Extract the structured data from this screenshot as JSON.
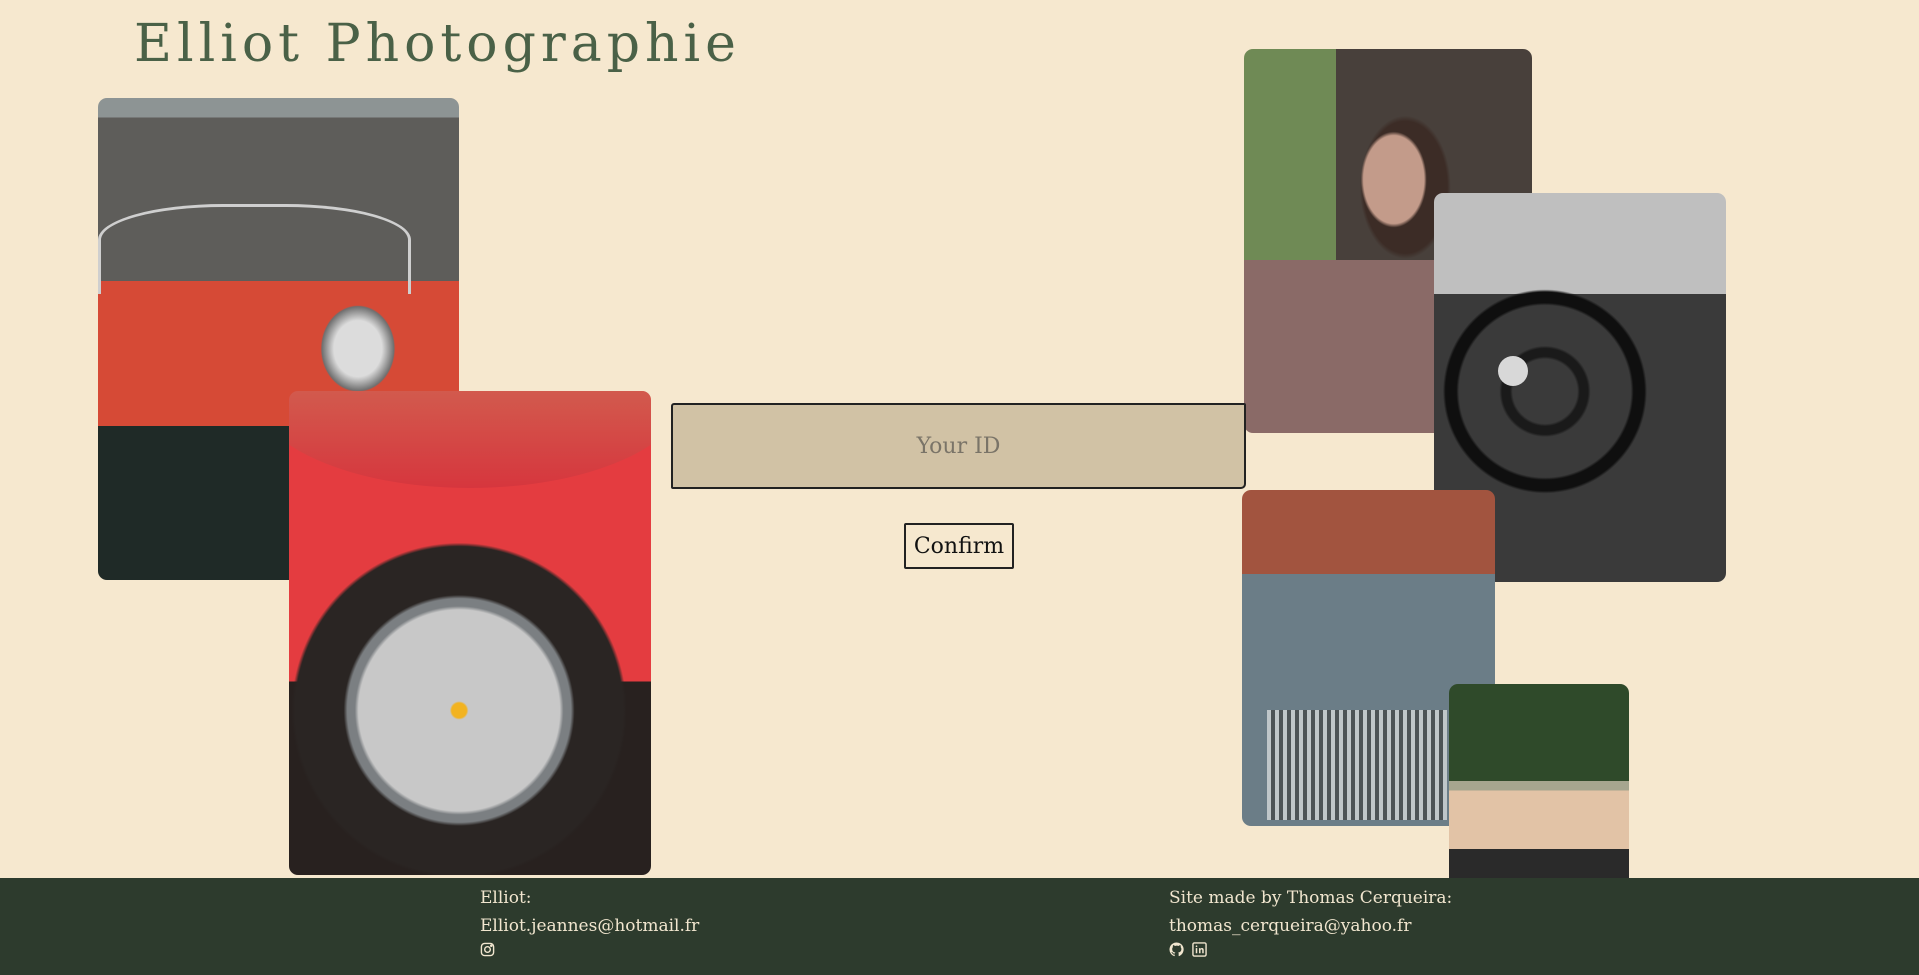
{
  "header": {
    "title": "Elliot Photographie"
  },
  "photos": [
    {
      "name": "red-roadster-photo"
    },
    {
      "name": "red-car-wheel-photo"
    },
    {
      "name": "woman-portrait-photo"
    },
    {
      "name": "steering-wheel-photo"
    },
    {
      "name": "jaguar-grille-photo"
    },
    {
      "name": "mustang-photo"
    }
  ],
  "login": {
    "id_placeholder": "Your ID",
    "id_value": "",
    "confirm_label": "Confirm"
  },
  "footer": {
    "owner_label": "Elliot:",
    "owner_email": "Elliot.jeannes@hotmail.fr",
    "owner_icons": [
      "instagram-icon"
    ],
    "credit_label": "Site made by Thomas Cerqueira:",
    "credit_email": "thomas_cerqueira@yahoo.fr",
    "credit_icons": [
      "github-icon",
      "linkedin-icon"
    ]
  },
  "colors": {
    "background": "#f6e8cf",
    "title": "#4a6147",
    "input_bg": "#d1c2a5",
    "footer_bg": "#2d3b2d",
    "footer_text": "#f1e6cf"
  }
}
